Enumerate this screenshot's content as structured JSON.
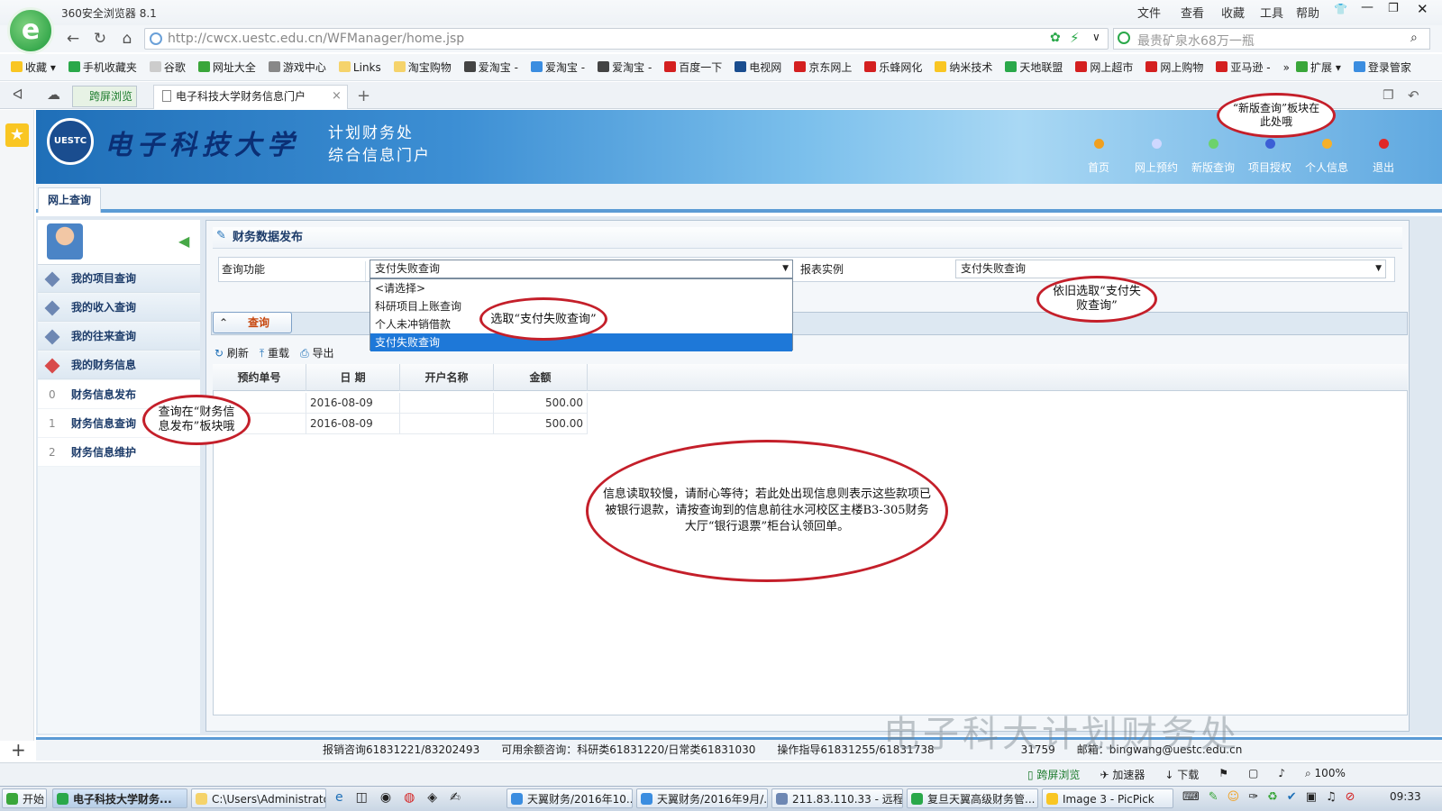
{
  "browser": {
    "app_title": "360安全浏览器 8.1",
    "menus": [
      "文件",
      "查看",
      "收藏",
      "工具",
      "帮助"
    ],
    "url": "http://cwcx.uestc.edu.cn/WFManager/home.jsp",
    "search_placeholder": "最贵矿泉水68万一瓶",
    "bookmarks": [
      "收藏",
      "手机收藏夹",
      "谷歌",
      "网址大全",
      "游戏中心",
      "Links",
      "淘宝购物",
      "爱淘宝",
      "爱淘宝",
      "爱淘宝",
      "百度一下",
      "电视网",
      "京东网上",
      "乐蜂网化",
      "纳米技术",
      "天地联盟",
      "网上超市",
      "网上购物",
      "亚马逊"
    ],
    "bookmark_right": [
      "扩展",
      "登录管家"
    ],
    "tab_cross": "跨屏浏览",
    "tab_active": "电子科技大学财务信息门户",
    "tab_close": "×",
    "tab_add": "+"
  },
  "portal": {
    "logo_text": "UESTC",
    "university": "电子科技大学",
    "subtitle1": "计划财务处",
    "subtitle2": "综合信息门户",
    "nav": [
      {
        "label": "首页",
        "color": "#f0a020"
      },
      {
        "label": "网上预约",
        "color": "#cfd8ff"
      },
      {
        "label": "新版查询",
        "color": "#6dd26d"
      },
      {
        "label": "项目授权",
        "color": "#3b5fd6"
      },
      {
        "label": "个人信息",
        "color": "#f5b02a"
      },
      {
        "label": "退出",
        "color": "#e02828"
      }
    ],
    "subtab": "网上查询"
  },
  "sidebar": {
    "items": [
      "我的项目查询",
      "我的收入查询",
      "我的往来查询",
      "我的财务信息"
    ],
    "subitems": [
      {
        "num": "0",
        "label": "财务信息发布"
      },
      {
        "num": "1",
        "label": "财务信息查询"
      },
      {
        "num": "2",
        "label": "财务信息维护"
      }
    ]
  },
  "main": {
    "panel_title": "财务数据发布",
    "func_label": "查询功能",
    "func_value": "支付失败查询",
    "report_label": "报表实例",
    "report_value": "支付失败查询",
    "dropdown_options": [
      "<请选择>",
      "科研项目上账查询",
      "个人未冲销借款",
      "支付失败查询"
    ],
    "query_button": "查询",
    "toolbar": [
      "刷新",
      "重载",
      "导出"
    ],
    "table": {
      "columns": [
        "预约单号",
        "日 期",
        "开户名称",
        "金额"
      ],
      "rows": [
        {
          "id": "",
          "date": "2016-08-09",
          "name": "",
          "amount": "500.00"
        },
        {
          "id": "",
          "date": "2016-08-09",
          "name": "",
          "amount": "500.00"
        }
      ]
    }
  },
  "footer": {
    "text": "报销咨询61831221/83202493　　可用余额咨询：科研类61831220/日常类61831030　　操作指导61831255/61831738　　　　　　　　31759　　邮箱：bingwang@uestc.edu.cn",
    "watermark": "电子科大计划财务处"
  },
  "callouts": {
    "new_query": "“新版查询”板块在此处哦",
    "select_pay_fail": "选取“支付失败查询”",
    "still_select": "依旧选取“支付失败查询”",
    "query_in_publish": "查询在“财务信息发布”板块哦",
    "slow_info": "信息读取较慢，请耐心等待；若此处出现信息则表示这些款项已被银行退款，请按查询到的信息前往水河校区主楼B3-305财务大厅“银行退票”柜台认领回单。"
  },
  "statusbar": [
    "跨屏浏览",
    "加速器",
    "下载",
    "100%"
  ],
  "taskbar": {
    "start": "开始",
    "tasks": [
      "电子科技大学财务...",
      "C:\\Users\\Administrator...",
      "天翼财务/2016年10...",
      "天翼财务/2016年9月/...",
      "211.83.110.33 - 远程...",
      "复旦天翼高级财务管...",
      "Image 3 - PicPick"
    ],
    "clock": "09:33"
  }
}
